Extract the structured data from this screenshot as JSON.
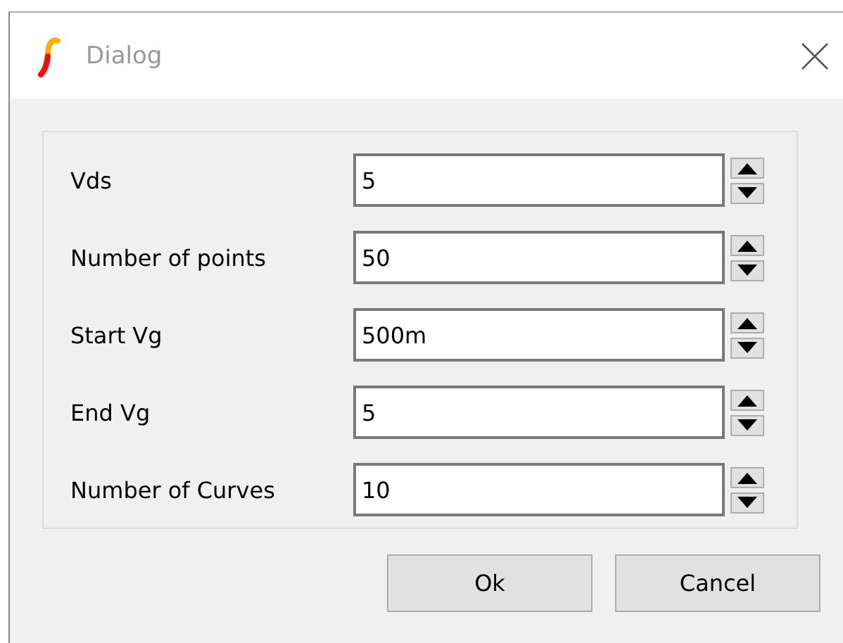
{
  "window": {
    "title": "Dialog"
  },
  "fields": [
    {
      "label": "Vds",
      "value": "5"
    },
    {
      "label": "Number of points",
      "value": "50"
    },
    {
      "label": "Start Vg",
      "value": "500m"
    },
    {
      "label": "End Vg",
      "value": "5"
    },
    {
      "label": "Number of Curves",
      "value": "10"
    }
  ],
  "buttons": [
    "Ok",
    "Cancel"
  ]
}
